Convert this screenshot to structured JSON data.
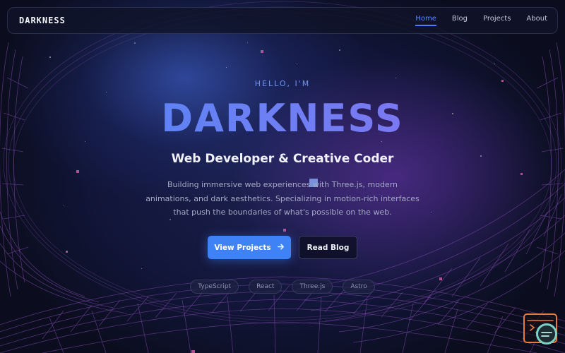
{
  "nav": {
    "brand": "DARKNESS",
    "links": [
      {
        "label": "Home",
        "active": true
      },
      {
        "label": "Blog",
        "active": false
      },
      {
        "label": "Projects",
        "active": false
      },
      {
        "label": "About",
        "active": false
      }
    ]
  },
  "hero": {
    "greeting": "HELLO, I'M",
    "name": "DARKNESS",
    "role": "Web Developer & Creative Coder",
    "description": "Building immersive web experiences with Three.js, modern animations, and dark aesthetics. Specializing in motion-rich interfaces that push the boundaries of what's possible on the web.",
    "primary_button": "View Projects",
    "primary_icon": "arrow-right-icon",
    "secondary_button": "Read Blog"
  },
  "tags": [
    "TypeScript",
    "React",
    "Three.js",
    "Astro"
  ],
  "colors": {
    "accent": "#3f82f5",
    "gradient_start": "#4a86f6",
    "gradient_end": "#8a6ef0",
    "background": "#0b0d1e",
    "mesh": "#8a4fb8",
    "badge_border": "#e87b3c"
  },
  "corner_badge_icon": "terminal-icon"
}
